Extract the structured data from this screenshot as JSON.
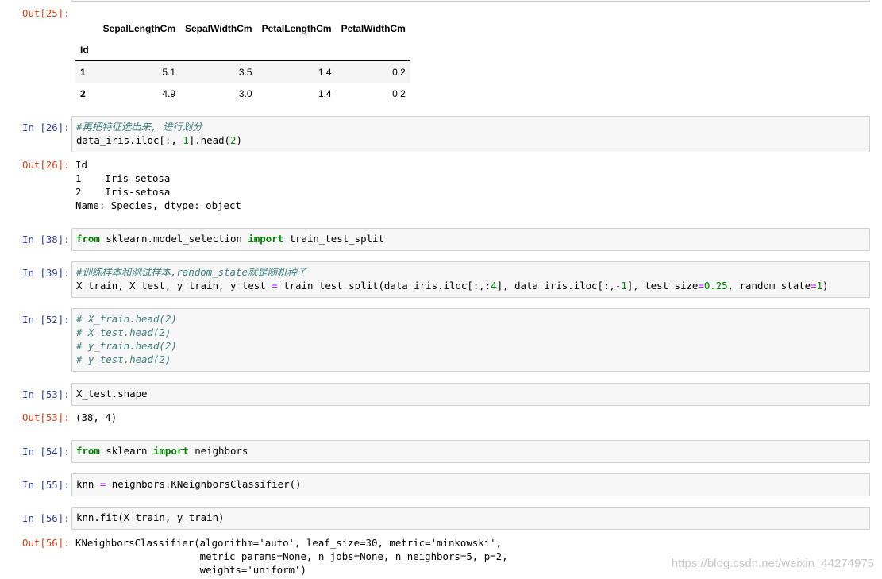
{
  "cells": {
    "c25": {
      "out_prompt": "Out[25]:"
    },
    "c26": {
      "in_prompt": "In [26]:",
      "out_prompt": "Out[26]:",
      "line1": "#再把特征选出来, 进行划分",
      "line2_a": "data_iris.iloc[:,",
      "line2_b": "-",
      "line2_c": "1",
      "line2_d": "].head(",
      "line2_e": "2",
      "line2_f": ")",
      "output": [
        "Id",
        "1    Iris-setosa",
        "2    Iris-setosa",
        "Name: Species, dtype: object"
      ]
    },
    "c38": {
      "in_prompt": "In [38]:",
      "kw1": "from",
      "mod": " sklearn.model_selection ",
      "kw2": "import",
      "rest": " train_test_split"
    },
    "c39": {
      "in_prompt": "In [39]:",
      "line1": "#训练样本和测试样本,random_state就是随机种子",
      "l2a": "X_train, X_test, y_train, y_test ",
      "l2b": "=",
      "l2c": " train_test_split(data_iris.iloc[:,:",
      "l2d": "4",
      "l2e": "], data_iris.iloc[:,",
      "l2f": "-",
      "l2g": "1",
      "l2h": "], test_size",
      "l2i": "=",
      "l2j": "0.25",
      "l2k": ", random_state",
      "l2l": "=",
      "l2m": "1",
      "l2n": ")"
    },
    "c52": {
      "in_prompt": "In [52]:",
      "lines": [
        "# X_train.head(2)",
        "# X_test.head(2)",
        "# y_train.head(2)",
        "# y_test.head(2)"
      ]
    },
    "c53": {
      "in_prompt": "In [53]:",
      "out_prompt": "Out[53]:",
      "code": "X_test.shape",
      "output": "(38, 4)"
    },
    "c54": {
      "in_prompt": "In [54]:",
      "kw1": "from",
      "mod": " sklearn ",
      "kw2": "import",
      "rest": " neighbors"
    },
    "c55": {
      "in_prompt": "In [55]:",
      "a": "knn ",
      "b": "=",
      "c": " neighbors.KNeighborsClassifier()"
    },
    "c56": {
      "in_prompt": "In [56]:",
      "out_prompt": "Out[56]:",
      "code": "knn.fit(X_train, y_train)",
      "output": [
        "KNeighborsClassifier(algorithm='auto', leaf_size=30, metric='minkowski',",
        "                     metric_params=None, n_jobs=None, n_neighbors=5, p=2,",
        "                     weights='uniform')"
      ]
    }
  },
  "dataframe": {
    "columns": [
      "SepalLengthCm",
      "SepalWidthCm",
      "PetalLengthCm",
      "PetalWidthCm"
    ],
    "index_name": "Id",
    "rows": [
      {
        "id": "1",
        "values": [
          "5.1",
          "3.5",
          "1.4",
          "0.2"
        ]
      },
      {
        "id": "2",
        "values": [
          "4.9",
          "3.0",
          "1.4",
          "0.2"
        ]
      }
    ]
  },
  "watermark": "https://blog.csdn.net/weixin_44274975"
}
